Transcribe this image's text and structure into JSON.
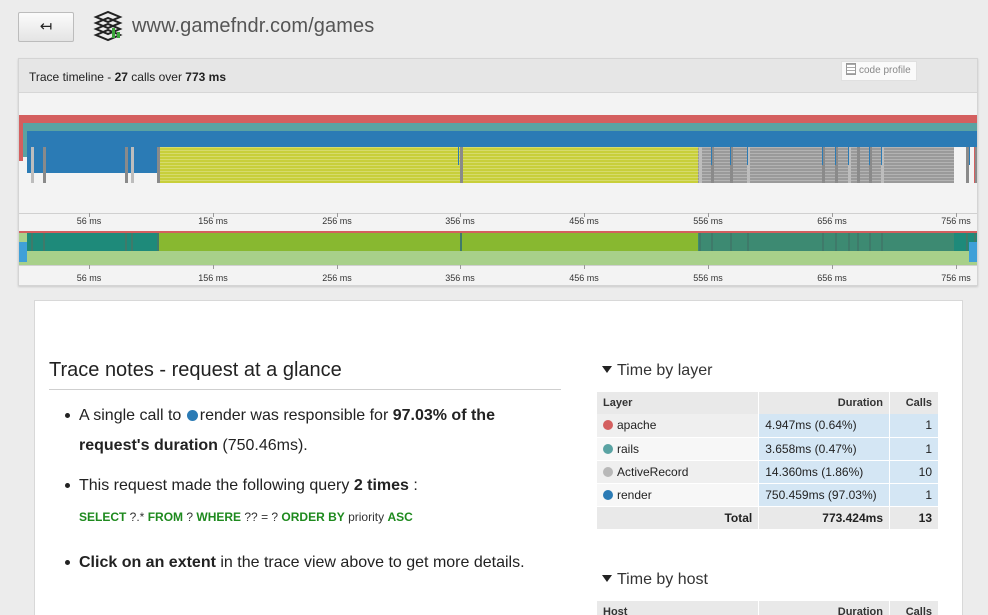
{
  "browser": {
    "back_label": "↤",
    "url": "www.gamefndr.com/games"
  },
  "timeline": {
    "title_prefix": "Trace timeline - ",
    "calls": "27",
    "calls_mid": " calls over ",
    "total_ms": "773 ms",
    "code_profile_label": "code profile",
    "tick_labels": [
      "56 ms",
      "156 ms",
      "256 ms",
      "356 ms",
      "456 ms",
      "556 ms",
      "656 ms",
      "756 ms"
    ],
    "colors": {
      "apache": "#d45f5f",
      "rails": "#5aa3a3",
      "render": "#2b7bb5",
      "view": "#c8cf3a",
      "activerecord": "#9a9a9a"
    }
  },
  "notes": {
    "title": "Trace notes - request at a glance",
    "item1": {
      "pre": "A single call to ",
      "layer": "render",
      "mid": " was responsible for ",
      "strong": "97.03% of the request's duration",
      "post": " (750.46ms)."
    },
    "item2": {
      "pre": "This request made the following query ",
      "strong": "2 times",
      "post": " :"
    },
    "sql": {
      "select": "SELECT",
      "t1": " ?.* ",
      "from": "FROM",
      "t2": " ? ",
      "where": "WHERE",
      "t3": " ?? = ? ",
      "orderby": "ORDER BY",
      "t4": " priority ",
      "asc": "ASC"
    },
    "item3": {
      "strong": "Click on an extent",
      "post": " in the trace view above to get more details."
    }
  },
  "layer_table": {
    "heading": "Time by layer",
    "headers": [
      "Layer",
      "Duration",
      "Calls"
    ],
    "rows": [
      {
        "layer": "apache",
        "duration": "4.947ms (0.64%)",
        "calls": "1",
        "color": "#d45f5f"
      },
      {
        "layer": "rails",
        "duration": "3.658ms (0.47%)",
        "calls": "1",
        "color": "#5aa3a3"
      },
      {
        "layer": "ActiveRecord",
        "duration": "14.360ms (1.86%)",
        "calls": "10",
        "color": "#b8b8b8"
      },
      {
        "layer": "render",
        "duration": "750.459ms (97.03%)",
        "calls": "1",
        "color": "#2b7bb5"
      }
    ],
    "total_label": "Total",
    "total_duration": "773.424ms",
    "total_calls": "13"
  },
  "host_table": {
    "heading": "Time by host",
    "headers": [
      "Host",
      "Duration",
      "Calls"
    ]
  }
}
